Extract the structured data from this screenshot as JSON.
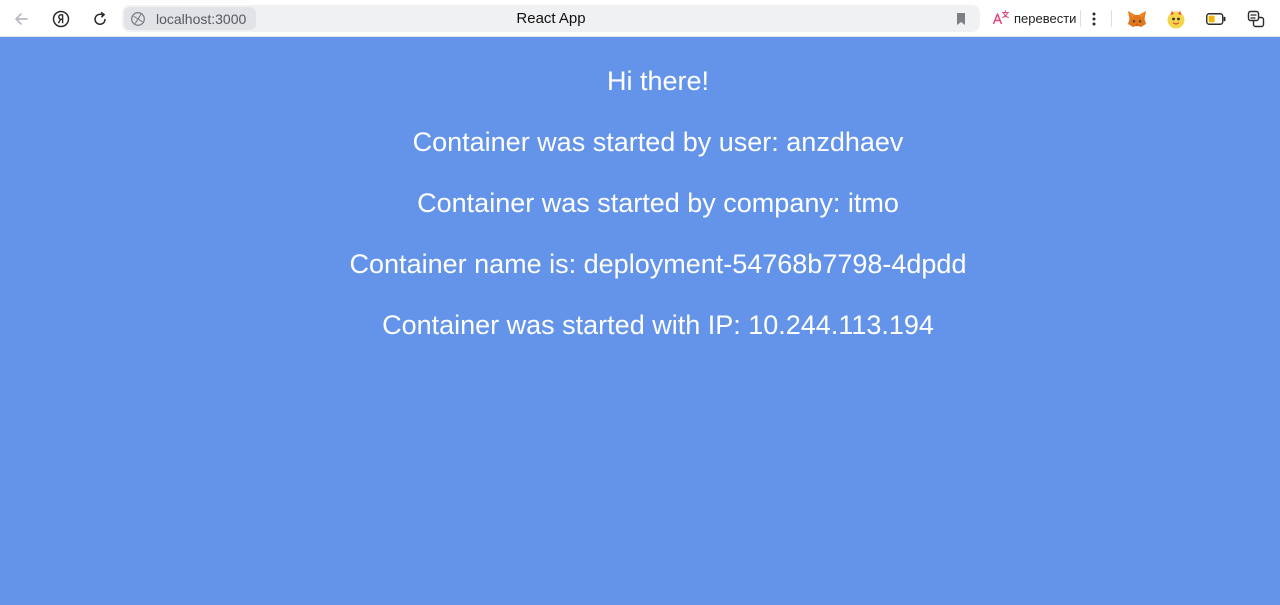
{
  "browser": {
    "url": "localhost:3000",
    "tab_title": "React App",
    "translate_label": "перевести",
    "icons": {
      "back": "back-arrow-icon",
      "yandex": "yandex-logo-icon",
      "reload": "reload-icon",
      "site": "site-settings-icon",
      "bookmark": "bookmark-icon",
      "translate": "translate-icon",
      "menu": "more-vertical-icon",
      "ext1": "metamask-fox-icon",
      "ext2": "extension-mascot-icon",
      "battery": "battery-icon",
      "tabs": "tabs-icon"
    }
  },
  "page": {
    "background": "#6494ea",
    "text_color": "#ffffff",
    "greeting": "Hi there!",
    "lines": [
      "Container was started by user: anzdhaev",
      "Container was started by company: itmo",
      "Container name is: deployment-54768b7798-4dpdd",
      "Container was started with IP: 10.244.113.194"
    ]
  }
}
